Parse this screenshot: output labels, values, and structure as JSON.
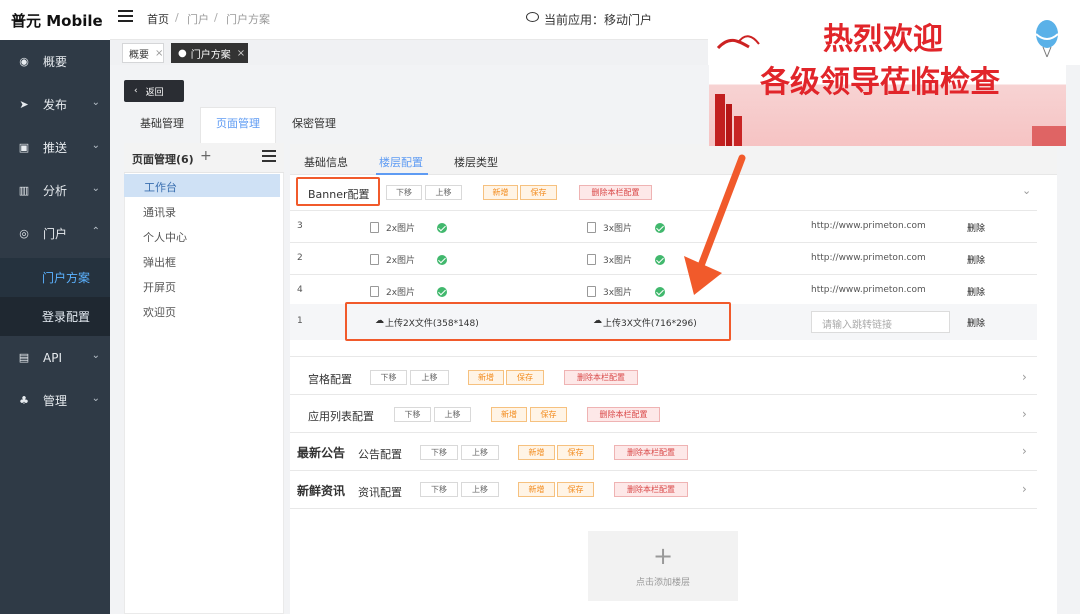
{
  "app": {
    "title": "普元 Mobile",
    "current_app_label": "当前应用：移动门户"
  },
  "breadcrumb": [
    "首页",
    "门户",
    "门户方案"
  ],
  "sidebar": {
    "items": [
      {
        "label": "概要",
        "icon": "dashboard-icon"
      },
      {
        "label": "发布",
        "icon": "send-icon"
      },
      {
        "label": "推送",
        "icon": "message-icon"
      },
      {
        "label": "分析",
        "icon": "chart-icon"
      },
      {
        "label": "门户",
        "icon": "portal-icon"
      },
      {
        "label": "API",
        "icon": "api-icon"
      },
      {
        "label": "管理",
        "icon": "org-icon"
      }
    ],
    "subitems": [
      "门户方案",
      "登录配置"
    ]
  },
  "tabs": [
    {
      "label": "概要"
    },
    {
      "label": "门户方案"
    }
  ],
  "back_button": "返回",
  "page_tabs": [
    "基础管理",
    "页面管理",
    "保密管理"
  ],
  "page_management": {
    "title": "页面管理(6)",
    "pages": [
      "工作台",
      "通讯录",
      "个人中心",
      "弹出框",
      "开屏页",
      "欢迎页"
    ]
  },
  "content_tabs": [
    "基础信息",
    "楼层配置",
    "楼层类型"
  ],
  "banner": {
    "title": "Banner配置",
    "buttons": [
      "下移",
      "上移",
      "新增",
      "保存",
      "删除本栏配置"
    ],
    "rows": [
      {
        "index": "3",
        "img2x": "2x图片",
        "img3x": "3x图片",
        "url": "http://www.primeton.com",
        "action": "删除"
      },
      {
        "index": "2",
        "img2x": "2x图片",
        "img3x": "3x图片",
        "url": "http://www.primeton.com",
        "action": "删除"
      },
      {
        "index": "4",
        "img2x": "2x图片",
        "img3x": "3x图片",
        "url": "http://www.primeton.com",
        "action": "删除"
      },
      {
        "index": "1",
        "upload2x": "上传2X文件(358*148)",
        "upload3x": "上传3X文件(716*296)",
        "url_placeholder": "请输入跳转链接",
        "action": "删除"
      }
    ]
  },
  "sections": [
    {
      "title": "宫格配置",
      "buttons": [
        "下移",
        "上移",
        "新增",
        "保存",
        "删除本栏配置"
      ]
    },
    {
      "title": "应用列表配置",
      "buttons": [
        "下移",
        "上移",
        "新增",
        "保存",
        "删除本栏配置"
      ]
    },
    {
      "prefix": "最新公告",
      "title": "公告配置",
      "buttons": [
        "下移",
        "上移",
        "新增",
        "保存",
        "删除本栏配置"
      ]
    },
    {
      "prefix": "新鲜资讯",
      "title": "资讯配置",
      "buttons": [
        "下移",
        "上移",
        "新增",
        "保存",
        "删除本栏配置"
      ]
    }
  ],
  "add_floor": {
    "label": "点击添加楼层"
  },
  "banner_image": {
    "line1": "热烈欢迎",
    "line2": "各级领导莅临检查"
  },
  "colors": {
    "sidebar": "#2f3a46",
    "accent": "#5e9bf3",
    "orange": "#f28a1b",
    "red": "#d94848",
    "annotation": "#f15a2b"
  }
}
